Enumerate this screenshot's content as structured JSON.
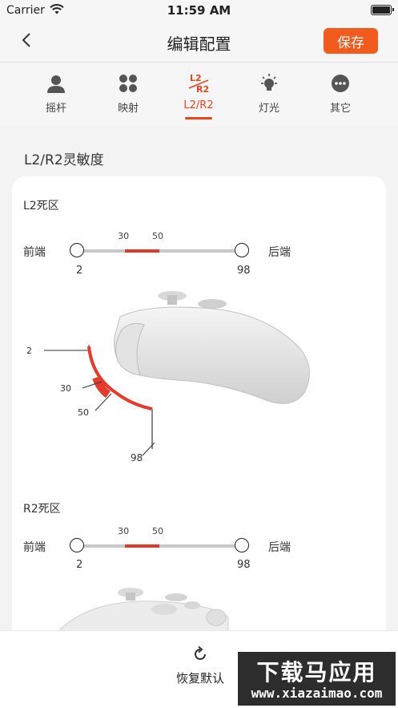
{
  "status": {
    "carrier": "Carrier",
    "time": "11:59 AM"
  },
  "nav": {
    "title": "编辑配置",
    "save": "保存"
  },
  "tabs": [
    {
      "label": "摇杆",
      "icon": "person-icon"
    },
    {
      "label": "映射",
      "icon": "dots-grid-icon"
    },
    {
      "label": "L2/R2",
      "icon": "trigger-icon",
      "active": true
    },
    {
      "label": "灯光",
      "icon": "light-bulb-icon"
    },
    {
      "label": "其它",
      "icon": "more-icon"
    }
  ],
  "trigger_icon_text": {
    "top": "L2",
    "bottom": "R2"
  },
  "section": {
    "title": "L2/R2灵敏度"
  },
  "l2": {
    "title": "L2死区",
    "left_label": "前端",
    "right_label": "后端",
    "min": 2,
    "max": 98,
    "low": 30,
    "high": 50,
    "min_label": "2",
    "max_label": "98",
    "low_label": "30",
    "high_label": "50",
    "diagram": {
      "v_min": "2",
      "v_low": "30",
      "v_high": "50",
      "v_max": "98"
    }
  },
  "r2": {
    "title": "R2死区",
    "left_label": "前端",
    "right_label": "后端",
    "min": 2,
    "max": 98,
    "low": 30,
    "high": 50,
    "min_label": "2",
    "max_label": "98",
    "low_label": "30",
    "high_label": "50"
  },
  "bottom": {
    "restore": "恢复默认"
  },
  "watermark": {
    "title": "下载马应用",
    "url": "www.xiazaimao.com"
  },
  "colors": {
    "accent": "#f25a1e",
    "range": "#e53a2a",
    "active_tab": "#e8451e"
  }
}
